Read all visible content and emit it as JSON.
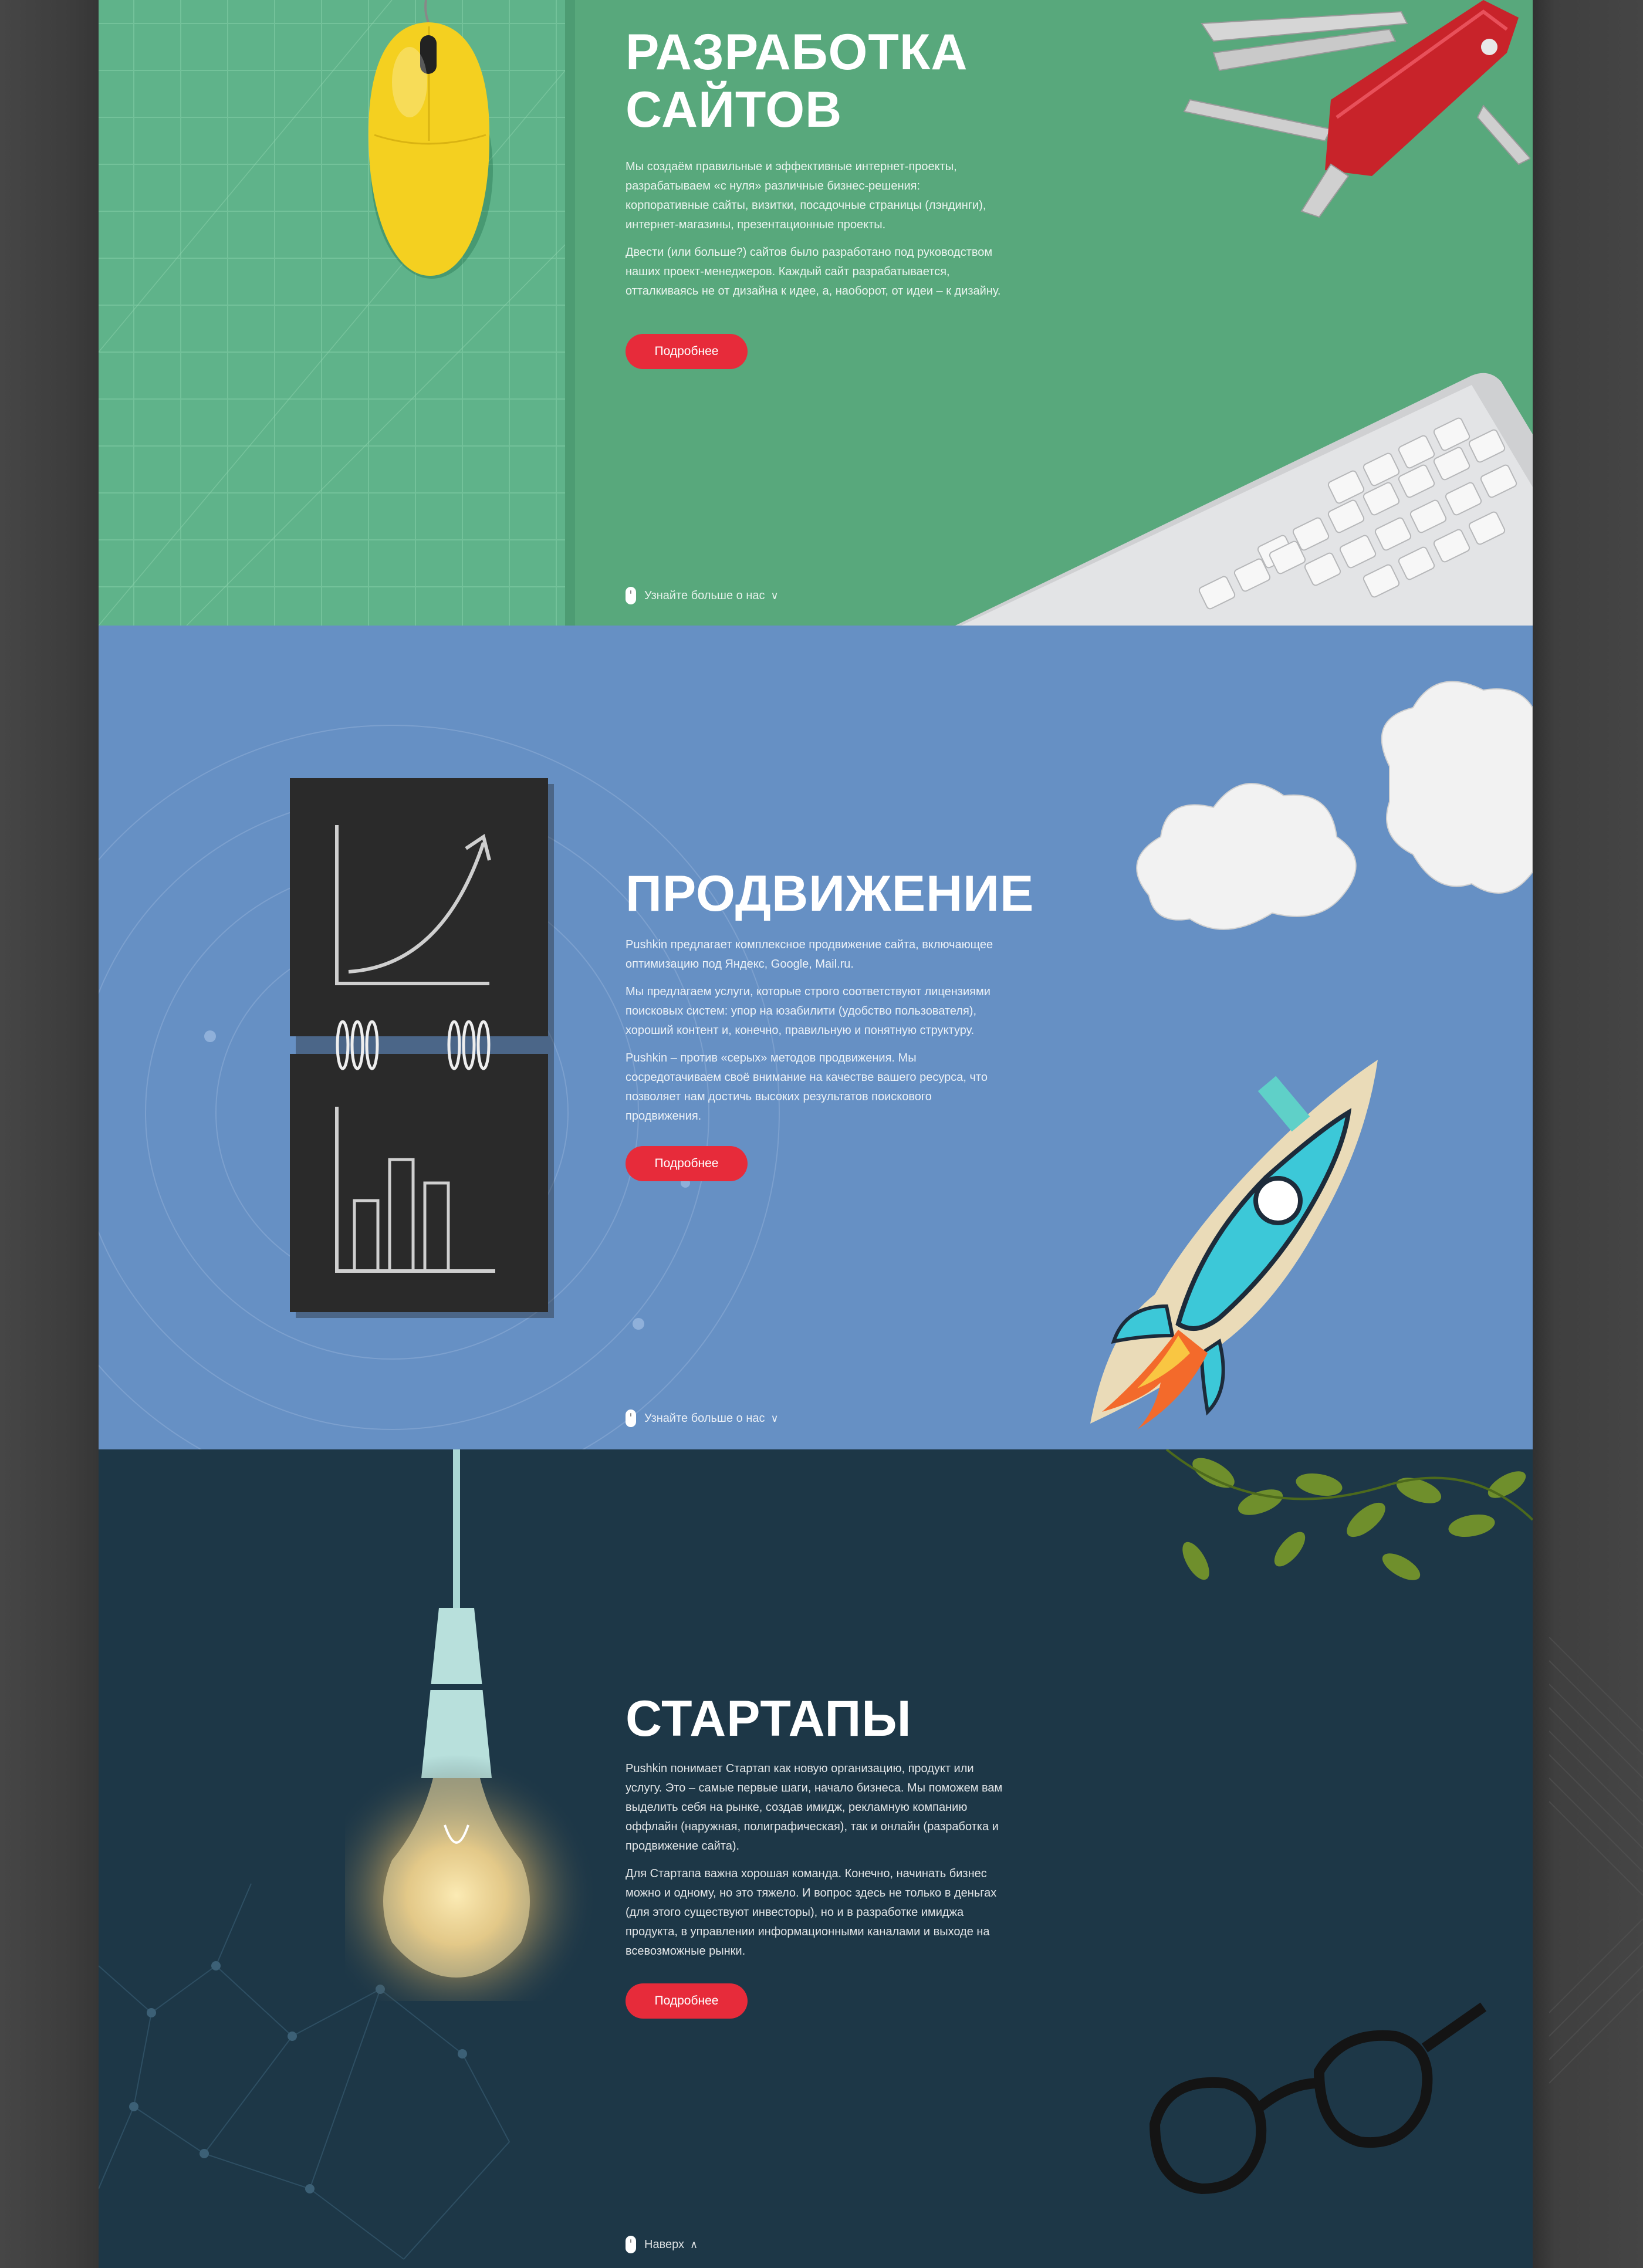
{
  "colors": {
    "web_bg": "#58a87c",
    "promo_bg": "#6690c4",
    "startup_bg": "#1d3747",
    "button": "#e72b3a",
    "page_bg": "#3e3e3e"
  },
  "sections": {
    "web": {
      "title_line1": "РАЗРАБОТКА",
      "title_line2": "САЙТОВ",
      "paragraphs": [
        "Мы создаём правильные и эффективные интернет-проекты, разрабатываем «с нуля» различные бизнес-решения: корпоративные сайты, визитки, посадочные страницы (лэндинги), интернет-магазины, презентационные проекты.",
        "Двести (или больше?) сайтов было разработано под руководством наших проект-менеджеров. Каждый сайт разрабатывается, отталкиваясь не от дизайна к идее, а, наоборот, от идеи – к дизайну."
      ],
      "button_label": "Подробнее",
      "more_label": "Узнайте больше о нас",
      "icons": [
        "mouse-icon",
        "chevron-down-icon"
      ],
      "illustrations": [
        "yellow-mouse",
        "swiss-knife",
        "keyboard",
        "cutting-mat-grid"
      ]
    },
    "promo": {
      "title": "ПРОДВИЖЕНИЕ",
      "paragraphs": [
        "Pushkin предлагает комплексное продвижение сайта, включающее оптимизацию под Яндекс, Google, Mail.ru.",
        "Мы предлагаем услуги, которые строго соответствуют лицензиями поисковых систем: упор на юзабилити (удобство пользователя), хороший контент и, конечно, правильную и понятную структуру.",
        "Pushkin – против «серых» методов продвижения. Мы сосредотачиваем своё внимание на качестве    вашего ресурса, что позволяет нам достичь высоких результатов поискового продвижения."
      ],
      "button_label": "Подробнее",
      "more_label": "Узнайте больше о нас",
      "illustrations": [
        "chalkboard-notebook",
        "paper-clouds",
        "paper-rocket"
      ]
    },
    "startup": {
      "title": "СТАРТАПЫ",
      "paragraphs": [
        "Pushkin понимает Стартап как новую организацию, продукт или услугу. Это – самые первые шаги, начало бизнеса. Мы поможем вам выделить себя на рынке, создав имидж, рекламную компанию оффлайн (наружная, полиграфическая), так и онлайн (разработка и продвижение сайта).",
        "Для Стартапа важна хорошая команда. Конечно, начинать бизнес можно и одному, но это тяжело. И вопрос здесь не только в деньгах (для этого существуют инвесторы), но и в разработке имиджа продукта, в управлении информационными каналами и выходе на всевозможные рынки."
      ],
      "button_label": "Подробнее",
      "top_label": "Наверх",
      "illustrations": [
        "light-bulb",
        "plant-leaves",
        "eyeglasses",
        "network-lines"
      ]
    }
  }
}
